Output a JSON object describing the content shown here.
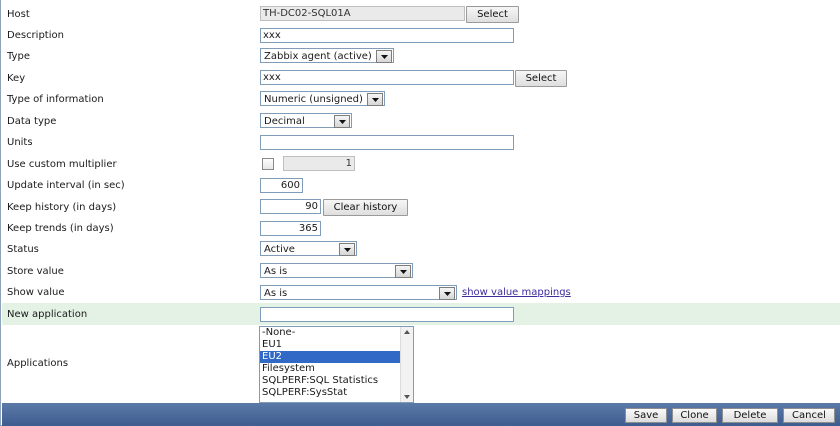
{
  "form": {
    "host": {
      "label": "Host",
      "value": "TH-DC02-SQL01A",
      "button": "Select"
    },
    "description": {
      "label": "Description",
      "value": "xxx"
    },
    "type": {
      "label": "Type",
      "value": "Zabbix agent (active)"
    },
    "key": {
      "label": "Key",
      "value": "xxx",
      "button": "Select"
    },
    "type_of_information": {
      "label": "Type of information",
      "value": "Numeric (unsigned)"
    },
    "data_type": {
      "label": "Data type",
      "value": "Decimal"
    },
    "units": {
      "label": "Units",
      "value": ""
    },
    "custom_multiplier": {
      "label": "Use custom multiplier",
      "checked": false,
      "value": "1"
    },
    "update_interval": {
      "label": "Update interval (in sec)",
      "value": "600"
    },
    "keep_history": {
      "label": "Keep history (in days)",
      "value": "90",
      "button": "Clear history"
    },
    "keep_trends": {
      "label": "Keep trends (in days)",
      "value": "365"
    },
    "status": {
      "label": "Status",
      "value": "Active"
    },
    "store_value": {
      "label": "Store value",
      "value": "As is"
    },
    "show_value": {
      "label": "Show value",
      "value": "As is",
      "link": "show value mappings"
    },
    "new_application": {
      "label": "New application",
      "value": ""
    },
    "applications": {
      "label": "Applications",
      "options": [
        "-None-",
        "EU1",
        "EU2",
        "Filesystem",
        "SQLPERF:SQL Statistics",
        "SQLPERF:SysStat"
      ],
      "selected": "EU2"
    }
  },
  "footer": {
    "save": "Save",
    "clone": "Clone",
    "delete": "Delete",
    "cancel": "Cancel"
  },
  "colors": {
    "footer_bar": "#4a6a9c",
    "highlight_row": "#e4f2e6",
    "selection": "#3169c6",
    "link": "#3d2d9b"
  }
}
